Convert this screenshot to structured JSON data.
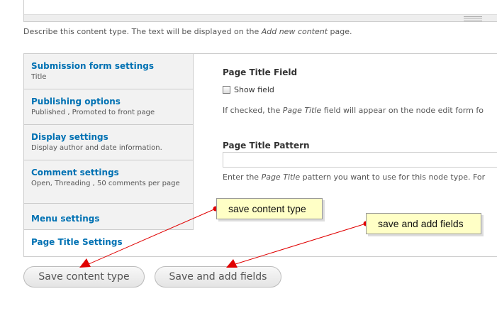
{
  "description": {
    "before": "Describe this content type. The text will be displayed on the ",
    "emphasis": "Add new content",
    "after": " page."
  },
  "vertical_tabs": [
    {
      "title": "Submission form settings",
      "summary": "Title"
    },
    {
      "title": "Publishing options",
      "summary": "Published , Promoted to front page"
    },
    {
      "title": "Display settings",
      "summary": "Display author and date information."
    },
    {
      "title": "Comment settings",
      "summary": "Open, Threading , 50 comments per page"
    },
    {
      "title": "Menu settings",
      "summary": ""
    },
    {
      "title": "Page Title Settings",
      "summary": "",
      "active": true
    }
  ],
  "page_title_field": {
    "heading": "Page Title Field",
    "checkbox_label": "Show field",
    "checked": false,
    "help_before": "If checked, the ",
    "help_emphasis": "Page Title",
    "help_after": " field will appear on the node edit form fo"
  },
  "page_title_pattern": {
    "heading": "Page Title Pattern",
    "value": "",
    "help_before": "Enter the ",
    "help_emphasis": "Page Title",
    "help_after": " pattern you want to use for this node type. For"
  },
  "actions": {
    "save_label": "Save content type",
    "save_add_label": "Save and add fields"
  },
  "annotations": {
    "save_callout": "save content type",
    "save_add_callout": "save and add fields"
  },
  "colors": {
    "link": "#0071b3",
    "callout_bg": "#ffffc6",
    "arrow": "#e00000"
  }
}
